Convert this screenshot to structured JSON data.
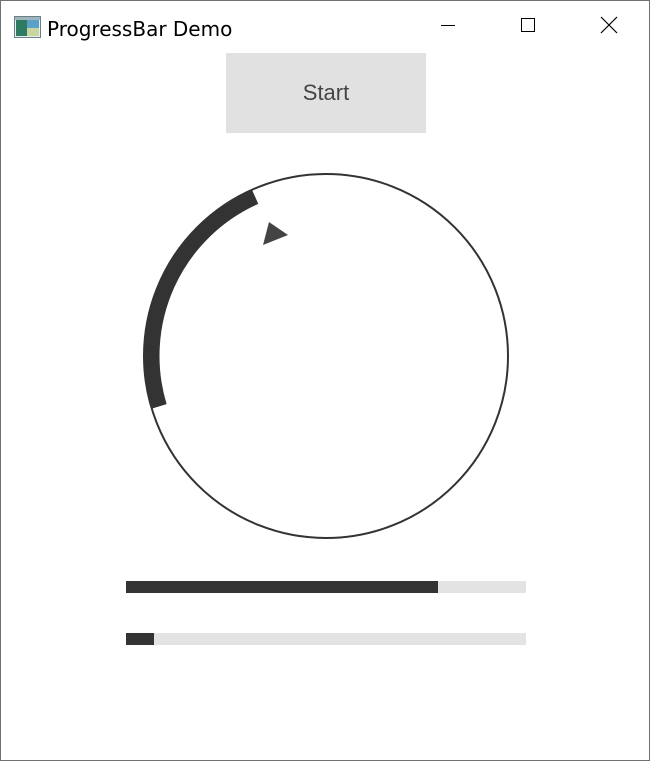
{
  "window": {
    "title": "ProgressBar Demo",
    "app_icon": "app-window-icon",
    "controls": {
      "minimize_icon": "minimize-icon",
      "maximize_icon": "maximize-icon",
      "close_icon": "close-icon"
    }
  },
  "start_button": {
    "label": "Start"
  },
  "circular_progress": {
    "progress_fraction": 0.23,
    "indicator_icon": "play-triangle-icon",
    "track_color": "#333333",
    "fill_color": "#333333"
  },
  "progress_bars": [
    {
      "progress_fraction": 0.78,
      "fill_color": "#333333",
      "track_color": "#e3e3e3"
    },
    {
      "progress_fraction": 0.07,
      "fill_color": "#333333",
      "track_color": "#e3e3e3"
    }
  ]
}
